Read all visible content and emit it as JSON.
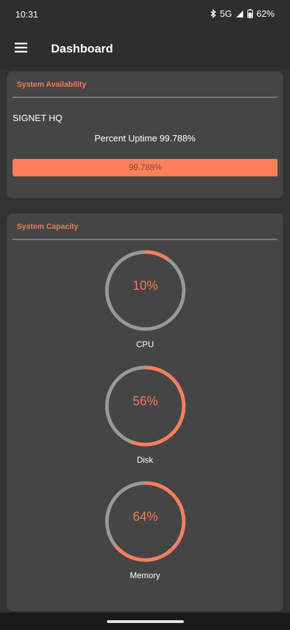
{
  "status_bar": {
    "time": "10:31",
    "network": "5G",
    "battery": "62%"
  },
  "app_bar": {
    "title": "Dashboard",
    "menu_icon": "hamburger-menu-icon"
  },
  "availability": {
    "header": "System Availability",
    "site": "SIGNET HQ",
    "uptime_text": "Percent Uptime 99.788%",
    "progress_label": "99.788%",
    "progress_value": 99.788
  },
  "capacity": {
    "header": "System Capacity",
    "gauges": [
      {
        "label": "CPU",
        "value_text": "10%",
        "value": 10
      },
      {
        "label": "Disk",
        "value_text": "56%",
        "value": 56
      },
      {
        "label": "Memory",
        "value_text": "64%",
        "value": 64
      }
    ]
  },
  "colors": {
    "accent": "#ff7f5c",
    "accent_text": "#f07a5c",
    "track": "#999999",
    "card": "#454545",
    "background": "#333333"
  }
}
